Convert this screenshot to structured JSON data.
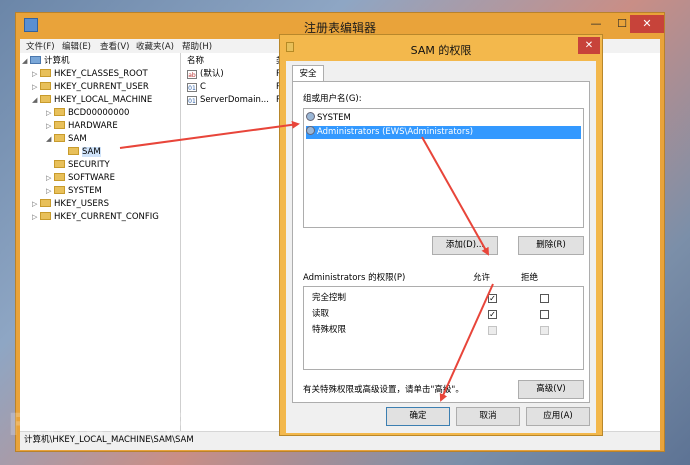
{
  "window": {
    "title": "注册表编辑器",
    "close": "✕",
    "minimize": "—",
    "maximize": "☐"
  },
  "menu": [
    "文件(F)",
    "编辑(E)",
    "查看(V)",
    "收藏夹(A)",
    "帮助(H)"
  ],
  "tree": [
    {
      "label": "计算机",
      "toggle": "◢"
    },
    {
      "label": "HKEY_CLASSES_ROOT",
      "toggle": "▷"
    },
    {
      "label": "HKEY_CURRENT_USER",
      "toggle": "▷"
    },
    {
      "label": "HKEY_LOCAL_MACHINE",
      "toggle": "◢"
    },
    {
      "label": "BCD00000000",
      "toggle": "▷"
    },
    {
      "label": "HARDWARE",
      "toggle": "▷"
    },
    {
      "label": "SAM",
      "toggle": "◢"
    },
    {
      "label": "SAM",
      "toggle": ""
    },
    {
      "label": "SECURITY",
      "toggle": ""
    },
    {
      "label": "SOFTWARE",
      "toggle": "▷"
    },
    {
      "label": "SYSTEM",
      "toggle": "▷"
    },
    {
      "label": "HKEY_USERS",
      "toggle": "▷"
    },
    {
      "label": "HKEY_CURRENT_CONFIG",
      "toggle": "▷"
    }
  ],
  "values": {
    "header": "名称",
    "type_header_partial": "类",
    "rows": [
      {
        "name": "(默认)",
        "type_partial": "R",
        "icon": "ab"
      },
      {
        "name": "C",
        "type_partial": "R",
        "icon": "01"
      },
      {
        "name": "ServerDomain...",
        "type_partial": "R",
        "icon": "01"
      }
    ]
  },
  "status": "计算机\\HKEY_LOCAL_MACHINE\\SAM\\SAM",
  "dialog": {
    "title": "SAM 的权限",
    "close": "✕",
    "tab": "安全",
    "group_label": "组或用户名(G):",
    "users": [
      "SYSTEM",
      "Administrators (EWS\\Administrators)"
    ],
    "add_button": "添加(D)...",
    "remove_button": "删除(R)",
    "perm_label": "Administrators 的权限(P)",
    "allow_header": "允许",
    "deny_header": "拒绝",
    "permissions": [
      {
        "name": "完全控制",
        "allow": "✓",
        "deny": ""
      },
      {
        "name": "读取",
        "allow": "✓",
        "deny": ""
      },
      {
        "name": "特殊权限",
        "allow": "",
        "deny": ""
      }
    ],
    "advanced_text": "有关特殊权限或高级设置，请单击\"高级\"。",
    "advanced_button": "高级(V)",
    "ok": "确定",
    "cancel": "取消",
    "apply": "应用(A)"
  },
  "colors": {
    "accent": "#f3b84c",
    "selection": "#3399ff",
    "arrow": "#e8453a"
  },
  "watermark": "FREEBUF"
}
